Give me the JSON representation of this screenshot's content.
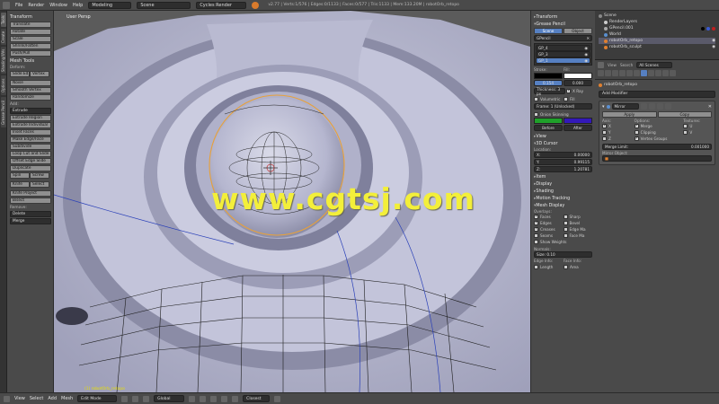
{
  "topbar": {
    "menus": [
      "File",
      "Render",
      "Window",
      "Help"
    ],
    "layout": "Modeling",
    "scene": "Scene",
    "engine": "Cycles Render",
    "stats": "v2.77 | Verts:1/576 | Edges:0/1133 | Faces:0/577 | Tris:1133 | Mem:133.20M | robotOrb_retopo"
  },
  "left_tabs": [
    "Tools",
    "Create",
    "Shading/UVs",
    "Options",
    "Grease Pencil"
  ],
  "toolshelf": {
    "transform_title": "Transform",
    "transform": [
      "Translate",
      "Rotate",
      "Scale",
      "Shrink/Fatten",
      "Push/Pull"
    ],
    "mesh_tools_title": "Mesh Tools",
    "deform_label": "Deform:",
    "slide_edge": "Slide Ed",
    "slide_vertex": "Vertex",
    "deform": [
      "Noise",
      "Smooth Vertex",
      "Randomize"
    ],
    "add_label": "Add:",
    "extrude": "Extrude",
    "add": [
      "Extrude Region",
      "Extrude Individual",
      "Inset Faces",
      "Make Edge/Face",
      "Subdivide",
      "Loop Cut and Slide",
      "Offset Edge Slide",
      "Duplicate"
    ],
    "spin": "Spin",
    "screw": "Screw",
    "knife": "Knife",
    "select": "Select",
    "add_end": [
      "Knife Project",
      "Bisect"
    ],
    "remove_label": "Remove:",
    "delete": "Delete",
    "merge": "Merge"
  },
  "viewport": {
    "label": "User Persp",
    "object_label": "(1) robotOrb_retopo",
    "watermark": "www.cgtsj.com"
  },
  "npanel": {
    "transform": "Transform",
    "grease_pencil": "Grease Pencil",
    "scene_btn": "Scene",
    "object_btn": "Object",
    "gpencil_field": "GPencil",
    "layers": [
      "GP_4",
      "GP_3",
      "GP_1"
    ],
    "stroke_label": "Stroke:",
    "fill_label": "Fill:",
    "stroke_value": "0.154",
    "fill_value": "0.000",
    "thickness": "Thickness: 3 px",
    "xray": "X Ray",
    "volumetric": "Volumetric",
    "fill_check": "Fill",
    "frame": "Frame: 1 (Unlocked)",
    "onion": "Onion Skinning",
    "before": "Before",
    "after": "After",
    "view": "View",
    "cursor_3d": "3D Cursor",
    "location": "Location:",
    "x_label": "X:",
    "y_label": "Y:",
    "z_label": "Z:",
    "x": "0.00000",
    "y": "0.99115",
    "z": "1.20781",
    "item": "Item",
    "display": "Display",
    "shading": "Shading",
    "motion_tracking": "Motion Tracking",
    "mesh_display": "Mesh Display",
    "overlays": "Overlays:",
    "overlay_left": [
      "Faces",
      "Edges",
      "Creases",
      "Seams"
    ],
    "overlay_right": [
      "Sharp",
      "Bevel",
      "Edge Ma",
      "Face Ma"
    ],
    "show_weights": "Show Weights",
    "normals": "Normals:",
    "normal_size": "Size: 0.10",
    "edge_info": "Edge Info:",
    "face_info": "Face Info:",
    "length": "Length",
    "area": "Area"
  },
  "outliner": {
    "rows": [
      "Scene",
      "RenderLayers",
      "GPencil.001",
      "World",
      "robotOrb_retopo",
      "robotOrb_sculpt"
    ],
    "menus": [
      "View",
      "Search"
    ],
    "filter": "All Scenes"
  },
  "props": {
    "object": "robotOrb_retopo",
    "add_modifier": "Add Modifier",
    "mirror": "Mirror",
    "apply": "Apply",
    "copy": "Copy",
    "axis": "Axis:",
    "options": "Options:",
    "textures": "Textures:",
    "axes": [
      "X",
      "Y",
      "Z"
    ],
    "opts": [
      "Merge",
      "Clipping",
      "Vertex Groups"
    ],
    "tex": [
      "U",
      "V"
    ],
    "merge_limit": "Merge Limit:",
    "merge_limit_value": "0.001000",
    "mirror_object": "Mirror Object:"
  },
  "bottombar": {
    "menus": [
      "View",
      "Select",
      "Add",
      "Mesh"
    ],
    "mode": "Edit Mode",
    "orientation": "Global",
    "snap": "Closest"
  },
  "colors": {
    "viewport_bg": "#5b5b5b",
    "mesh_light": "#c2c3dc",
    "mesh_dark": "#8c8da8",
    "accent_blue": "#5680c2",
    "watermark": "#f3ef3a",
    "stroke_color": "#000000",
    "fill_color": "#ffffff",
    "onion_before": "#1fa02a",
    "onion_after": "#3319b8"
  }
}
